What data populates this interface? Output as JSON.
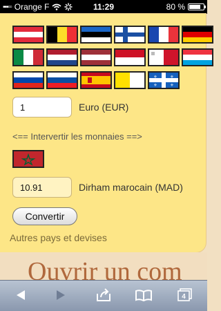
{
  "status_bar": {
    "carrier": "Orange F",
    "time": "11:29",
    "battery": "80 %",
    "battery_level": 0.8
  },
  "flags": [
    {
      "name": "austria-flag",
      "kind": "h",
      "colors": [
        "#e32b3c",
        "#ffffff",
        "#e32b3c"
      ]
    },
    {
      "name": "belgium-flag",
      "kind": "v",
      "colors": [
        "#000000",
        "#fddc29",
        "#ee2e36"
      ]
    },
    {
      "name": "estonia-flag",
      "kind": "h",
      "colors": [
        "#1a66c7",
        "#000000",
        "#ffffff"
      ]
    },
    {
      "name": "finland-flag",
      "kind": "finland",
      "colors": [
        "#ffffff",
        "#1a4fa3"
      ]
    },
    {
      "name": "france-flag",
      "kind": "v",
      "colors": [
        "#1a47b0",
        "#ffffff",
        "#e9333b"
      ]
    },
    {
      "name": "germany-flag",
      "kind": "h",
      "colors": [
        "#000000",
        "#dd0000",
        "#ffce00"
      ]
    },
    {
      "name": "italy-flag",
      "kind": "v",
      "colors": [
        "#0b8a45",
        "#ffffff",
        "#cf2b37"
      ]
    },
    {
      "name": "netherlands-flag",
      "kind": "h",
      "colors": [
        "#b01c2e",
        "#ffffff",
        "#21468b"
      ]
    },
    {
      "name": "latvia-flag",
      "kind": "h",
      "colors": [
        "#9e3039",
        "#ffffff",
        "#9e3039"
      ]
    },
    {
      "name": "monaco-flag",
      "kind": "h",
      "colors": [
        "#ce1126",
        "#ffffff"
      ]
    },
    {
      "name": "malta-flag",
      "kind": "malta",
      "colors": [
        "#ffffff",
        "#cf142b"
      ]
    },
    {
      "name": "luxembourg-flag",
      "kind": "h",
      "colors": [
        "#ef3340",
        "#ffffff",
        "#00a3e0"
      ]
    },
    {
      "name": "slovenia-flag",
      "kind": "h",
      "colors": [
        "#ffffff",
        "#0147ab",
        "#e1251b"
      ]
    },
    {
      "name": "slovakia-flag",
      "kind": "h",
      "colors": [
        "#ffffff",
        "#0b4ea2",
        "#ee1c25"
      ]
    },
    {
      "name": "spain-flag",
      "kind": "spain",
      "colors": [
        "#c60b1e",
        "#ffc400"
      ]
    },
    {
      "name": "vatican-flag",
      "kind": "v",
      "colors": [
        "#ffe000",
        "#ffffff"
      ]
    },
    {
      "name": "quebec-flag",
      "kind": "quebec",
      "colors": [
        "#1560bd",
        "#ffffff"
      ]
    }
  ],
  "converter": {
    "amount": "1",
    "from_currency": "Euro (EUR)",
    "swap_text": "<== Intervertir les monnaies ==>",
    "result": "10.91",
    "to_currency": "Dirham marocain (MAD)",
    "to_flag_colors": [
      "#c1272d",
      "#006233"
    ],
    "convert_label": "Convertir",
    "more_link": "Autres pays et devises"
  },
  "underlay": {
    "text": "Ouvrir un com"
  },
  "toolbar": {
    "tabs_count": "4"
  }
}
